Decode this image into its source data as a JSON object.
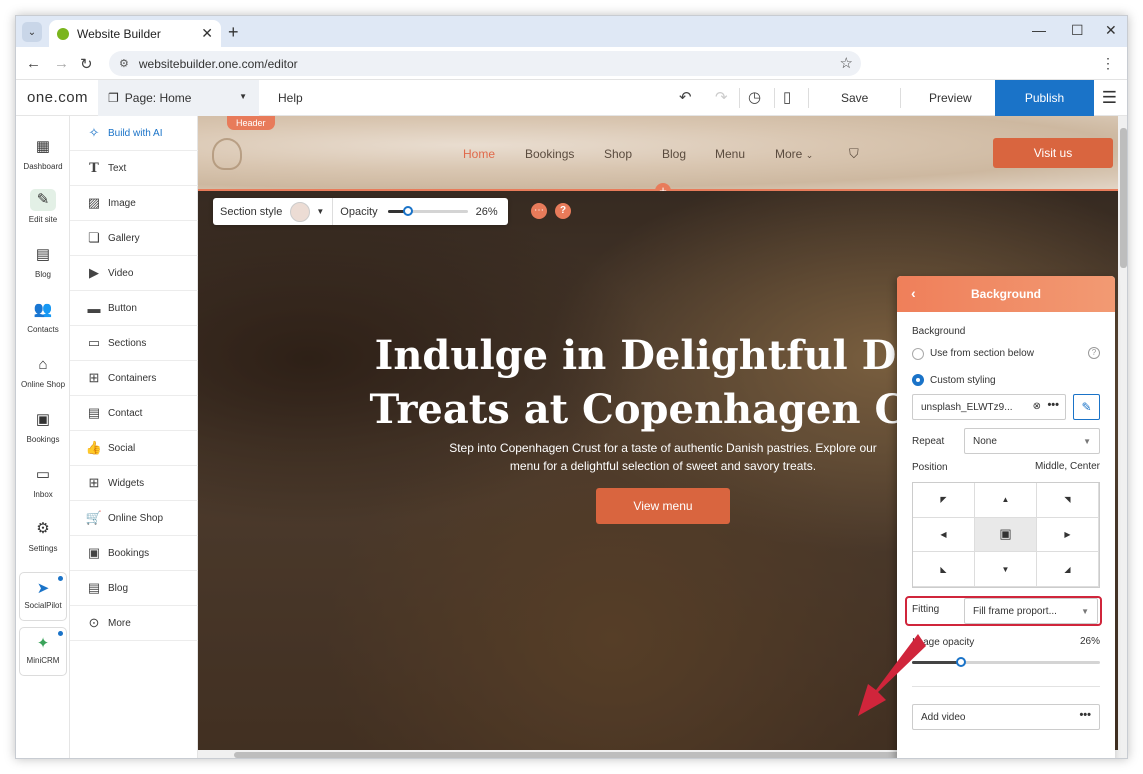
{
  "browser": {
    "tab_title": "Website Builder",
    "url": "websitebuilder.one.com/editor"
  },
  "topbar": {
    "logo": "one.com",
    "page_prefix": "Page:",
    "page_name": "Home",
    "help": "Help",
    "save": "Save",
    "preview": "Preview",
    "publish": "Publish"
  },
  "rail": [
    {
      "icon": "dashboard-icon",
      "label": "Dashboard"
    },
    {
      "icon": "edit-site-icon",
      "label": "Edit site"
    },
    {
      "icon": "blog-icon",
      "label": "Blog"
    },
    {
      "icon": "contacts-icon",
      "label": "Contacts"
    },
    {
      "icon": "online-shop-icon",
      "label": "Online Shop"
    },
    {
      "icon": "bookings-icon",
      "label": "Bookings"
    },
    {
      "icon": "inbox-icon",
      "label": "Inbox"
    },
    {
      "icon": "settings-icon",
      "label": "Settings"
    }
  ],
  "rail_cards": [
    {
      "icon": "socialpilot-icon",
      "label": "SocialPilot"
    },
    {
      "icon": "minicrm-icon",
      "label": "MiniCRM"
    }
  ],
  "elements": [
    {
      "icon": "sparkle-icon",
      "label": "Build with AI"
    },
    {
      "icon": "text-icon",
      "label": "Text"
    },
    {
      "icon": "image-icon",
      "label": "Image"
    },
    {
      "icon": "gallery-icon",
      "label": "Gallery"
    },
    {
      "icon": "video-icon",
      "label": "Video"
    },
    {
      "icon": "button-icon",
      "label": "Button"
    },
    {
      "icon": "sections-icon",
      "label": "Sections"
    },
    {
      "icon": "containers-icon",
      "label": "Containers"
    },
    {
      "icon": "contact-icon",
      "label": "Contact"
    },
    {
      "icon": "social-icon",
      "label": "Social"
    },
    {
      "icon": "widgets-icon",
      "label": "Widgets"
    },
    {
      "icon": "cart-icon",
      "label": "Online Shop"
    },
    {
      "icon": "bookings-icon",
      "label": "Bookings"
    },
    {
      "icon": "blog-icon",
      "label": "Blog"
    },
    {
      "icon": "more-icon",
      "label": "More"
    }
  ],
  "site": {
    "header_tag": "Header",
    "nav": [
      "Home",
      "Bookings",
      "Shop",
      "Blog",
      "Menu",
      "More"
    ],
    "visit_button": "Visit us",
    "hero_title_line1": "Indulge in Delightful Dan",
    "hero_title_line2": "Treats at Copenhagen Cru",
    "hero_subtitle": "Step into Copenhagen Crust for a taste of authentic Danish pastries. Explore our menu for a delightful selection of sweet and savory treats.",
    "hero_button": "View menu"
  },
  "section_toolbar": {
    "section_style": "Section style",
    "opacity_label": "Opacity",
    "opacity_value": "26%",
    "opacity_fraction": 0.26
  },
  "background_panel": {
    "title": "Background",
    "section_label": "Background",
    "option_from_below": "Use from section below",
    "option_custom": "Custom styling",
    "file_name": "unsplash_ELWTz9...",
    "repeat_label": "Repeat",
    "repeat_value": "None",
    "position_label": "Position",
    "position_value": "Middle, Center",
    "fitting_label": "Fitting",
    "fitting_value": "Fill frame proport...",
    "image_opacity_label": "Image opacity",
    "image_opacity_value": "26%",
    "image_opacity_fraction": 0.26,
    "add_video": "Add video"
  },
  "colors": {
    "accent_orange": "#e87b5a",
    "publish_blue": "#1a73c8",
    "highlight_red": "#d0253b"
  }
}
